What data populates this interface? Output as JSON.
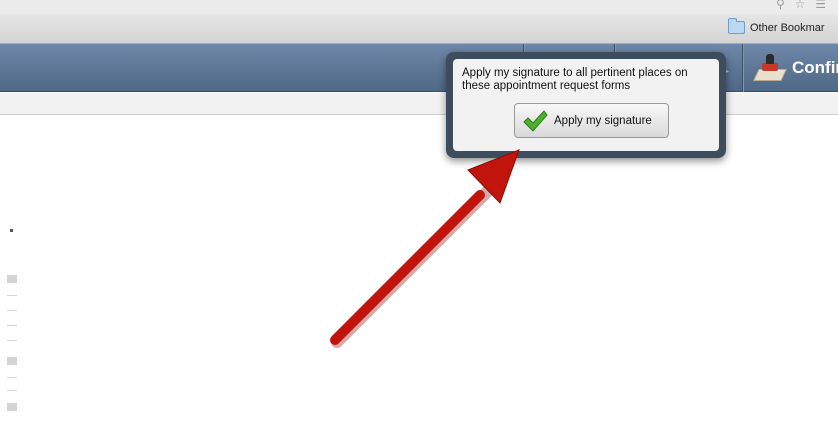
{
  "browser": {
    "toolbar_icons": [
      "zoom-icon",
      "star-icon",
      "menu-icon"
    ],
    "bookmarks_bar": {
      "folder_label": "Other Bookmar"
    }
  },
  "app_toolbar": {
    "confirm_label": "Confir",
    "colors": {
      "top": "#6f87a8",
      "bottom": "#4f6887"
    }
  },
  "popover": {
    "message": "Apply my signature to all pertinent places on these appointment request forms",
    "button_label": "Apply my signature",
    "colors": {
      "frame": "#3e4d5d",
      "check": "#4caf2f"
    }
  },
  "annotation": {
    "type": "arrow",
    "color": "#c0140c",
    "points_to": "popover"
  }
}
